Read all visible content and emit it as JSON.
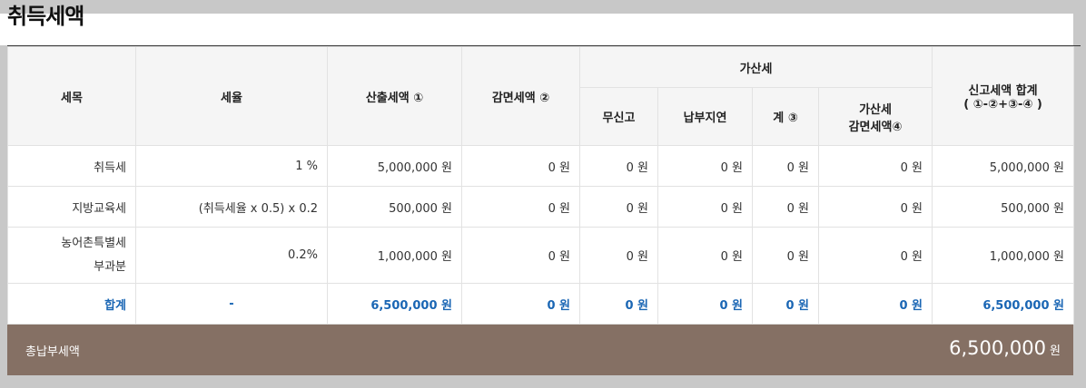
{
  "title": "취득세액",
  "headers": {
    "item": "세목",
    "rate": "세율",
    "calc": "산출세액 ①",
    "reduce": "감면세액 ②",
    "penalty_group": "가산세",
    "no_report": "무신고",
    "late_pay": "납부지연",
    "sum3": "계 ③",
    "penalty_reduce_line1": "가산세",
    "penalty_reduce_line2": "감면세액④",
    "total_line1": "신고세액 합계",
    "total_line2": "( ①-②+③-④ )"
  },
  "rows": [
    {
      "item": "취득세",
      "item2": "",
      "rate": "1 %",
      "calc": "5,000,000 원",
      "reduce": "0 원",
      "no_report": "0 원",
      "late_pay": "0 원",
      "sum3": "0 원",
      "penalty_reduce": "0 원",
      "total": "5,000,000 원"
    },
    {
      "item": "지방교육세",
      "item2": "",
      "rate": "(취득세율 x 0.5) x 0.2",
      "calc": "500,000 원",
      "reduce": "0 원",
      "no_report": "0 원",
      "late_pay": "0 원",
      "sum3": "0 원",
      "penalty_reduce": "0 원",
      "total": "500,000 원"
    },
    {
      "item": "농어촌특별세",
      "item2": "부과분",
      "rate": "0.2%",
      "calc": "1,000,000 원",
      "reduce": "0 원",
      "no_report": "0 원",
      "late_pay": "0 원",
      "sum3": "0 원",
      "penalty_reduce": "0 원",
      "total": "1,000,000 원"
    }
  ],
  "total_row": {
    "item": "합계",
    "rate": "-",
    "calc": "6,500,000 원",
    "reduce": "0 원",
    "no_report": "0 원",
    "late_pay": "0 원",
    "sum3": "0 원",
    "penalty_reduce": "0 원",
    "total": "6,500,000 원"
  },
  "footer": {
    "label": "총납부세액",
    "amount": "6,500,000",
    "unit": "원"
  }
}
